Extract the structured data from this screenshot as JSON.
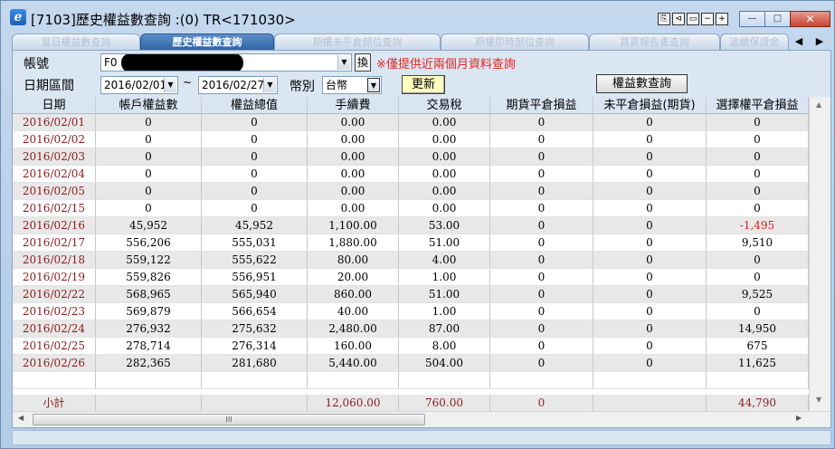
{
  "window": {
    "title": "[7103]歷史權益數查詢 :(0) TR<171030>",
    "app_icon_glyph": "e",
    "mini_buttons": [
      "⎘",
      "⊲",
      "▭",
      "−",
      "+"
    ],
    "controls": {
      "minimize": "—",
      "maximize": "□",
      "close": "✕"
    }
  },
  "tabs": [
    {
      "label": "當日權益數查詢",
      "active": false
    },
    {
      "label": "歷史權益數查詢",
      "active": true
    },
    {
      "label": "期權未平倉部位查詢",
      "active": false
    },
    {
      "label": "期權即時部位查詢",
      "active": false
    },
    {
      "label": "買賣報告書查詢",
      "active": false
    },
    {
      "label": "追繳保證金",
      "active": false
    }
  ],
  "tab_scroll": {
    "left": "◀",
    "right": "▶"
  },
  "form": {
    "account_label": "帳號",
    "account_value": "F0",
    "swap_label": "換",
    "notice": "※僅提供近兩個月資料查詢",
    "date_range_label": "日期區間",
    "date_from": "2016/02/01",
    "date_sep": "~",
    "date_to": "2016/02/27",
    "currency_label": "幣別",
    "currency_value": "台幣",
    "update_button": "更新",
    "query_button": "權益數查詢"
  },
  "table": {
    "columns": [
      "日期",
      "帳戶權益數",
      "權益總值",
      "手續費",
      "交易稅",
      "期貨平倉損益",
      "未平倉損益(期貨)",
      "選擇權平倉損益"
    ],
    "rows": [
      [
        "2016/02/01",
        "0",
        "0",
        "0.00",
        "0.00",
        "0",
        "0",
        "0"
      ],
      [
        "2016/02/02",
        "0",
        "0",
        "0.00",
        "0.00",
        "0",
        "0",
        "0"
      ],
      [
        "2016/02/03",
        "0",
        "0",
        "0.00",
        "0.00",
        "0",
        "0",
        "0"
      ],
      [
        "2016/02/04",
        "0",
        "0",
        "0.00",
        "0.00",
        "0",
        "0",
        "0"
      ],
      [
        "2016/02/05",
        "0",
        "0",
        "0.00",
        "0.00",
        "0",
        "0",
        "0"
      ],
      [
        "2016/02/15",
        "0",
        "0",
        "0.00",
        "0.00",
        "0",
        "0",
        "0"
      ],
      [
        "2016/02/16",
        "45,952",
        "45,952",
        "1,100.00",
        "53.00",
        "0",
        "0",
        "-1,495"
      ],
      [
        "2016/02/17",
        "556,206",
        "555,031",
        "1,880.00",
        "51.00",
        "0",
        "0",
        "9,510"
      ],
      [
        "2016/02/18",
        "559,122",
        "555,622",
        "80.00",
        "4.00",
        "0",
        "0",
        "0"
      ],
      [
        "2016/02/19",
        "559,826",
        "556,951",
        "20.00",
        "1.00",
        "0",
        "0",
        "0"
      ],
      [
        "2016/02/22",
        "568,965",
        "565,940",
        "860.00",
        "51.00",
        "0",
        "0",
        "9,525"
      ],
      [
        "2016/02/23",
        "569,879",
        "566,654",
        "40.00",
        "1.00",
        "0",
        "0",
        "0"
      ],
      [
        "2016/02/24",
        "276,932",
        "275,632",
        "2,480.00",
        "87.00",
        "0",
        "0",
        "14,950"
      ],
      [
        "2016/02/25",
        "278,714",
        "276,314",
        "160.00",
        "8.00",
        "0",
        "0",
        "675"
      ],
      [
        "2016/02/26",
        "282,365",
        "281,680",
        "5,440.00",
        "504.00",
        "0",
        "0",
        "11,625"
      ]
    ],
    "total": [
      "小計",
      "",
      "",
      "12,060.00",
      "760.00",
      "0",
      "",
      "44,790"
    ]
  },
  "scrollbar": {
    "up": "▲",
    "down": "▼",
    "left": "◀",
    "right": "▶",
    "grip": "III"
  },
  "colors": {
    "date_text": "#8b1c1c",
    "negative": "#d81e1e",
    "notice": "#e0261e",
    "active_tab": "#2f64a6"
  }
}
